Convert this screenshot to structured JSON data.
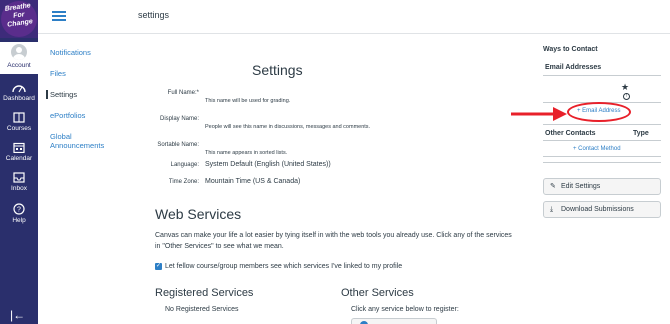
{
  "global_nav": {
    "logo_text": "Breathe For Change",
    "account": "Account",
    "items": [
      {
        "label": "Dashboard",
        "icon": "dashboard-icon"
      },
      {
        "label": "Courses",
        "icon": "courses-icon"
      },
      {
        "label": "Calendar",
        "icon": "calendar-icon"
      },
      {
        "label": "Inbox",
        "icon": "inbox-icon"
      },
      {
        "label": "Help",
        "icon": "help-icon"
      }
    ],
    "collapse_glyph": "|←"
  },
  "topbar": {
    "title": "settings"
  },
  "subnav": [
    {
      "label": "Notifications"
    },
    {
      "label": "Files"
    },
    {
      "label": "Settings"
    },
    {
      "label": "ePortfolios"
    },
    {
      "label": "Global Announcements"
    }
  ],
  "main": {
    "title": "Settings",
    "full_name_label": "Full Name:*",
    "full_name_note": "This name will be used for grading.",
    "display_name_label": "Display Name:",
    "display_name_note": "People will see this name in discussions, messages and comments.",
    "sortable_name_label": "Sortable Name:",
    "sortable_name_note": "This name appears in sorted lists.",
    "language_label": "Language:",
    "language_value": "System Default (English (United States))",
    "timezone_label": "Time Zone:",
    "timezone_value": "Mountain Time (US & Canada)",
    "web_services_title": "Web Services",
    "web_services_desc": "Canvas can make your life a lot easier by tying itself in with the web tools you already use. Click any of the services in \"Other Services\" to see what we mean.",
    "web_services_checkbox": "Let fellow course/group members see which services I've linked to my profile",
    "registered_title": "Registered Services",
    "registered_none": "No Registered Services",
    "other_title": "Other Services",
    "other_desc": "Click any service below to register:"
  },
  "right": {
    "ways_to_contact": "Ways to Contact",
    "email_addresses": "Email Addresses",
    "star": "★",
    "info": "!",
    "add_email": "+ Email Address",
    "other_contacts": "Other Contacts",
    "type": "Type",
    "add_contact": "+ Contact Method",
    "edit_settings": "Edit Settings",
    "download_submissions": "Download Submissions"
  },
  "colors": {
    "nav_bg": "#2a2f6c",
    "link": "#2d7fc6",
    "annotation": "#e8202a"
  }
}
